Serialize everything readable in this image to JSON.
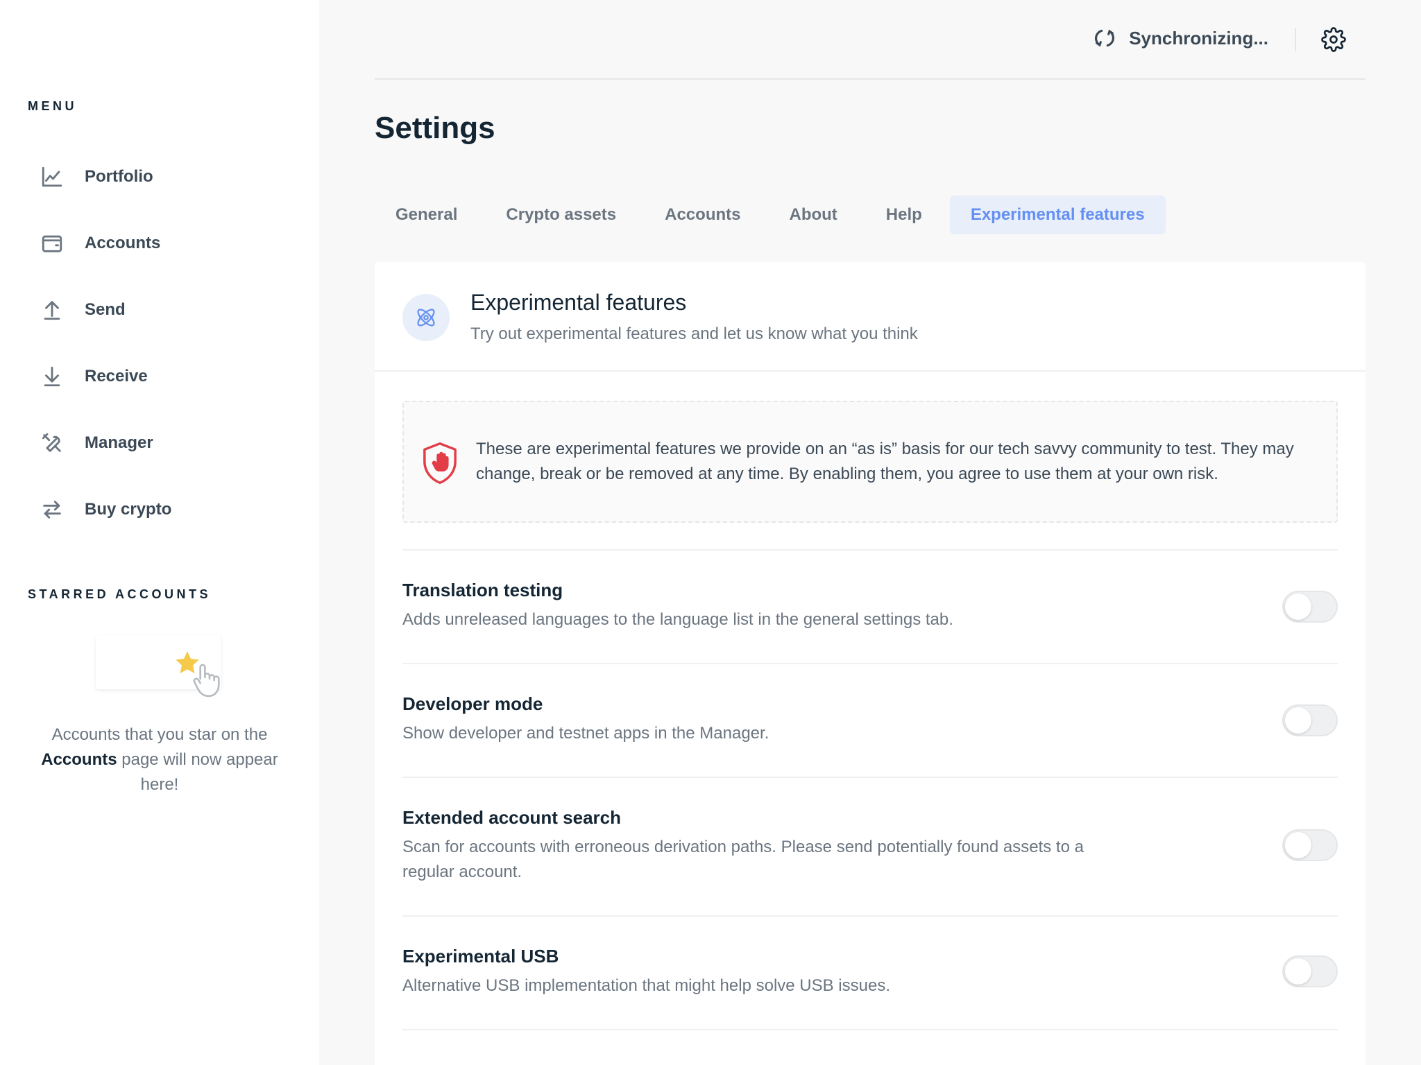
{
  "sidebar": {
    "menu_title": "MENU",
    "items": [
      {
        "label": "Portfolio",
        "icon": "chart-line-icon"
      },
      {
        "label": "Accounts",
        "icon": "wallet-icon"
      },
      {
        "label": "Send",
        "icon": "arrow-up-icon"
      },
      {
        "label": "Receive",
        "icon": "arrow-down-icon"
      },
      {
        "label": "Manager",
        "icon": "tools-icon"
      },
      {
        "label": "Buy crypto",
        "icon": "exchange-icon"
      }
    ],
    "starred_title": "STARRED ACCOUNTS",
    "starred_text_1": "Accounts that you star on the",
    "starred_text_bold": "Accounts",
    "starred_text_2": "page will now appear here!"
  },
  "topbar": {
    "sync_text": "Synchronizing..."
  },
  "page_title": "Settings",
  "tabs": [
    {
      "label": "General"
    },
    {
      "label": "Crypto assets"
    },
    {
      "label": "Accounts"
    },
    {
      "label": "About"
    },
    {
      "label": "Help"
    },
    {
      "label": "Experimental features",
      "active": true
    }
  ],
  "card": {
    "title": "Experimental features",
    "subtitle": "Try out experimental features and let us know what you think",
    "warning": "These are experimental features we provide on an “as is” basis for our tech savvy community to test. They may change, break or be removed at any time. By enabling them, you agree to use them at your own risk.",
    "rows": [
      {
        "title": "Translation testing",
        "desc": "Adds unreleased languages to the language list in the general settings tab.",
        "enabled": false
      },
      {
        "title": "Developer mode",
        "desc": "Show developer and testnet apps in the Manager.",
        "enabled": false
      },
      {
        "title": "Extended account search",
        "desc": "Scan for accounts with erroneous derivation paths. Please send potentially found assets to a regular account.",
        "enabled": false
      },
      {
        "title": "Experimental USB",
        "desc": "Alternative USB implementation that might help solve USB issues.",
        "enabled": false
      }
    ]
  },
  "colors": {
    "accent": "#6490f1",
    "accent_bg": "#e8eefa",
    "warning_red": "#e23d47",
    "star_yellow": "#f5c94b"
  }
}
